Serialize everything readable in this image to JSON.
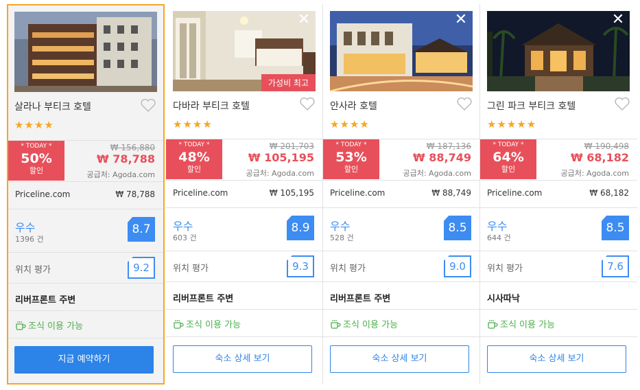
{
  "cards": [
    {
      "name": "살라나 부티크 호텔",
      "stars": "★★★★",
      "today_label": "* TODAY *",
      "discount": "50%",
      "discount_word": "할인",
      "original_price": "₩ 156,880",
      "price": "₩ 78,788",
      "supplier": "공급처: Agoda.com",
      "partner_name": "Priceline.com",
      "partner_price": "₩  78,788",
      "grade": "우수",
      "review_count": "1396 건",
      "score": "8.7",
      "location_label": "위치 평가",
      "location_score": "9.2",
      "area": "리버프론트 주변",
      "breakfast": "조식 이용 가능",
      "button": "지금 예약하기",
      "badge": "",
      "show_close": false
    },
    {
      "name": "다바라 부티크 호텔",
      "stars": "★★★★",
      "today_label": "* TODAY *",
      "discount": "48%",
      "discount_word": "할인",
      "original_price": "₩ 201,703",
      "price": "₩ 105,195",
      "supplier": "공급처: Agoda.com",
      "partner_name": "Priceline.com",
      "partner_price": "₩  105,195",
      "grade": "우수",
      "review_count": "603 건",
      "score": "8.9",
      "location_label": "위치 평가",
      "location_score": "9.3",
      "area": "리버프론트 주변",
      "breakfast": "조식 이용 가능",
      "button": "숙소 상세 보기",
      "badge": "가성비 최고",
      "show_close": true
    },
    {
      "name": "안사라 호텔",
      "stars": "★★★★",
      "today_label": "* TODAY *",
      "discount": "53%",
      "discount_word": "할인",
      "original_price": "₩ 187,136",
      "price": "₩ 88,749",
      "supplier": "공급처: Agoda.com",
      "partner_name": "Priceline.com",
      "partner_price": "₩  88,749",
      "grade": "우수",
      "review_count": "528 건",
      "score": "8.5",
      "location_label": "위치 평가",
      "location_score": "9.0",
      "area": "리버프론트 주변",
      "breakfast": "조식 이용 가능",
      "button": "숙소 상세 보기",
      "badge": "",
      "show_close": true
    },
    {
      "name": "그린 파크 부티크 호텔",
      "stars": "★★★★★",
      "today_label": "* TODAY *",
      "discount": "64%",
      "discount_word": "할인",
      "original_price": "₩ 190,498",
      "price": "₩ 68,182",
      "supplier": "공급처: Agoda.com",
      "partner_name": "Priceline.com",
      "partner_price": "₩  68,182",
      "grade": "우수",
      "review_count": "644 건",
      "score": "8.5",
      "location_label": "위치 평가",
      "location_score": "7.6",
      "area": "시사따낙",
      "breakfast": "조식 이용 가능",
      "button": "숙소 상세 보기",
      "badge": "",
      "show_close": true
    }
  ],
  "icons": {
    "close": "close-icon",
    "heart": "heart-icon",
    "breakfast": "coffee-cup-icon"
  },
  "colors": {
    "accent_blue": "#2c83e8",
    "discount_red": "#e7505a",
    "star_orange": "#f5a623",
    "selected_border": "#f6a623",
    "breakfast_green": "#4cae4c"
  }
}
